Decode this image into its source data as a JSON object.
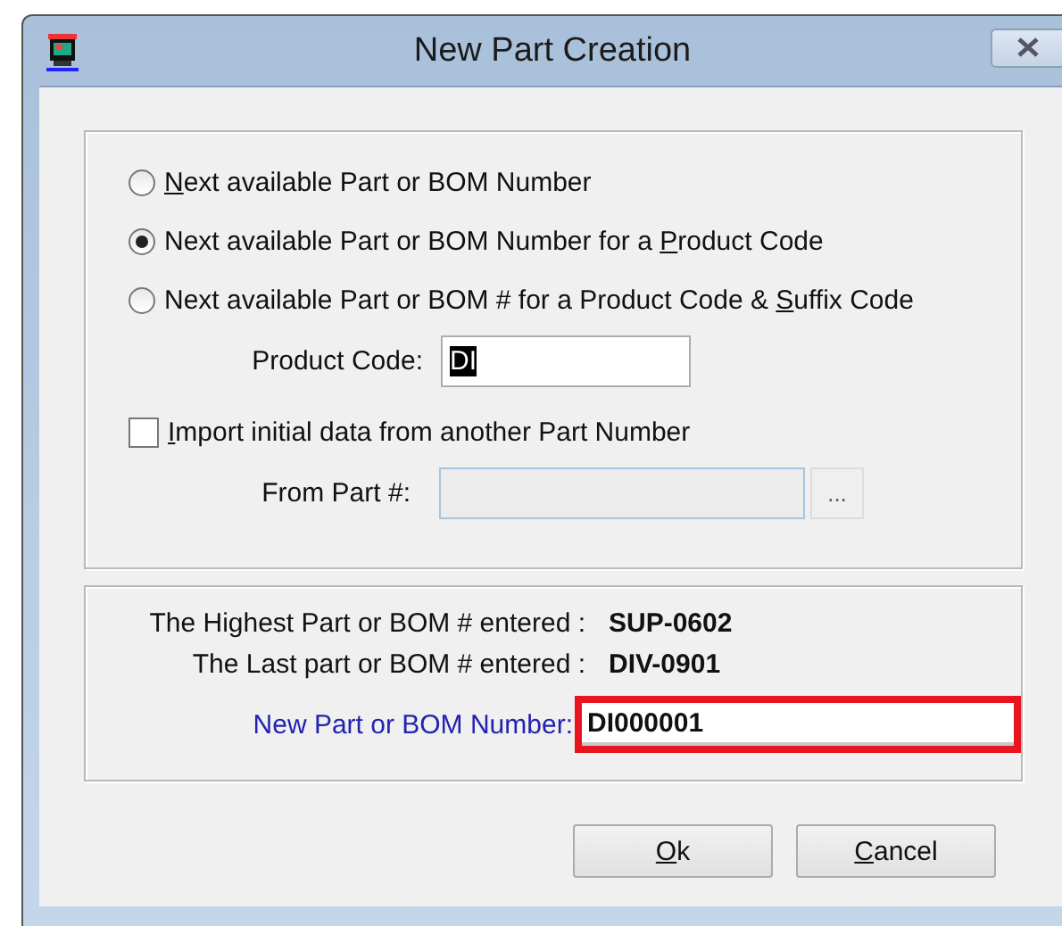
{
  "window": {
    "title": "New Part Creation"
  },
  "numbering_options": [
    {
      "access_key": "N",
      "label_after": "ext available Part or BOM Number",
      "selected": false
    },
    {
      "label_before": "Next available Part or BOM Number for a ",
      "access_key": "P",
      "label_after": "roduct Code",
      "selected": true
    },
    {
      "label_before": "Next available Part or BOM # for a Product Code & ",
      "access_key": "S",
      "label_after": "uffix Code",
      "selected": false
    }
  ],
  "product_code": {
    "label": "Product Code:",
    "value": "DI",
    "value_selected": true
  },
  "import_option": {
    "access_key": "I",
    "label_after": "mport initial data from another Part Number",
    "checked": false
  },
  "from_part": {
    "label": "From Part #:",
    "disabled": true,
    "browse_button": "..."
  },
  "summary": [
    {
      "label": "The Highest Part or BOM # entered :",
      "value": "SUP-0602"
    },
    {
      "label": "The Last part or BOM # entered :",
      "value": "DIV-0901"
    }
  ],
  "new_number": {
    "label": "New Part or BOM Number:",
    "value": "DI000001",
    "highlighted": true
  },
  "buttons": [
    {
      "access_key": "O",
      "label_after": "k"
    },
    {
      "access_key": "C",
      "label_after": "ancel"
    }
  ]
}
